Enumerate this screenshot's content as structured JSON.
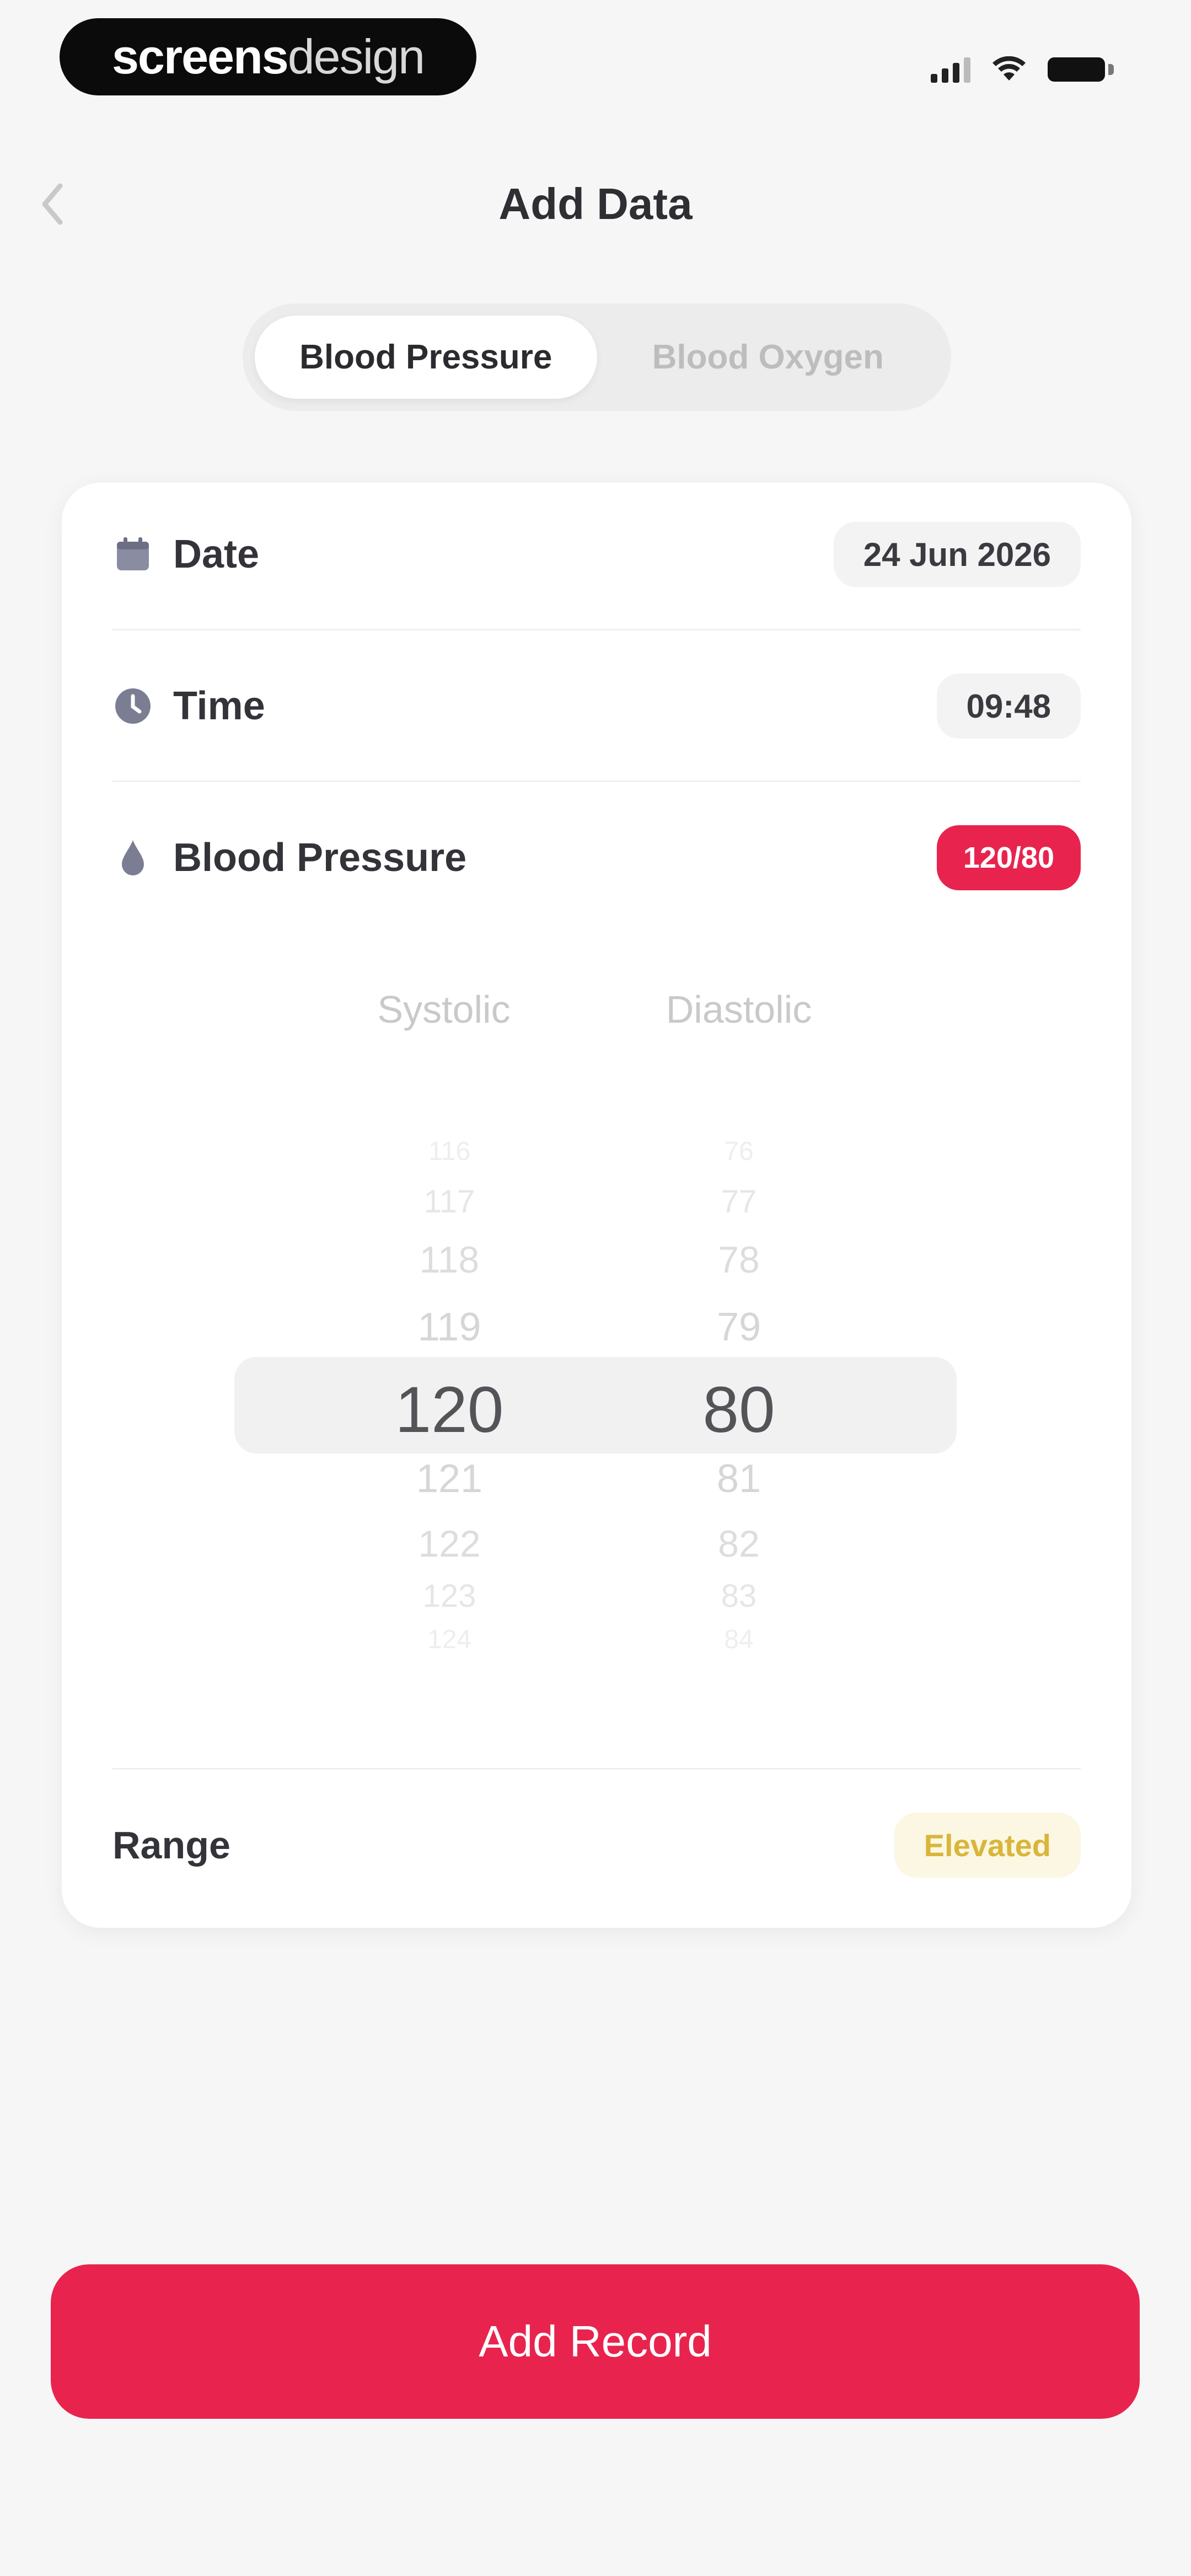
{
  "brand": {
    "name_bold": "screens",
    "name_light": "design"
  },
  "header": {
    "title": "Add Data"
  },
  "tabs": [
    {
      "label": "Blood Pressure",
      "active": true
    },
    {
      "label": "Blood Oxygen",
      "active": false
    }
  ],
  "form": {
    "date": {
      "label": "Date",
      "value": "24 Jun 2026"
    },
    "time": {
      "label": "Time",
      "value": "09:48"
    },
    "blood_pressure": {
      "label": "Blood Pressure",
      "value": "120/80"
    },
    "picker": {
      "systolic_label": "Systolic",
      "diastolic_label": "Diastolic",
      "systolic_values": [
        "116",
        "117",
        "118",
        "119",
        "120",
        "121",
        "122",
        "123",
        "124"
      ],
      "diastolic_values": [
        "76",
        "77",
        "78",
        "79",
        "80",
        "81",
        "82",
        "83",
        "84"
      ],
      "selected_index": 4
    },
    "range": {
      "label": "Range",
      "value": "Elevated"
    }
  },
  "actions": {
    "add_record": "Add Record"
  },
  "colors": {
    "accent": "#e8244e",
    "elevated_text": "#d9b53a",
    "elevated_bg": "#fbf7e3",
    "background": "#f6f6f6"
  },
  "icons": [
    "back-chevron-icon",
    "calendar-icon",
    "clock-icon",
    "blood-drop-icon",
    "signal-icon",
    "wifi-icon",
    "battery-icon"
  ]
}
